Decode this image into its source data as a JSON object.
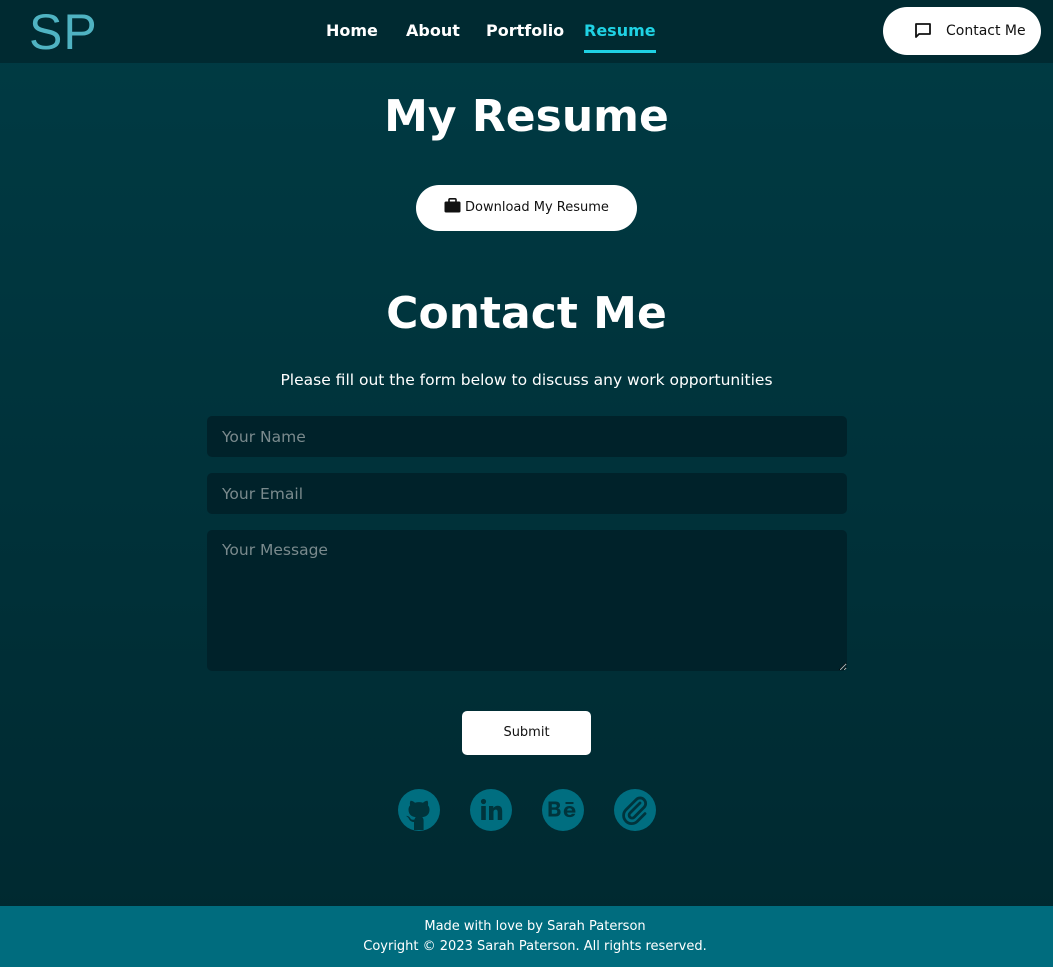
{
  "header": {
    "logo": "SP",
    "nav": [
      {
        "label": "Home",
        "active": false
      },
      {
        "label": "About",
        "active": false
      },
      {
        "label": "Portfolio",
        "active": false
      },
      {
        "label": "Resume",
        "active": true
      }
    ],
    "contact_button": {
      "label": "Contact Me",
      "icon": "chat-bubble-icon"
    }
  },
  "resume": {
    "title": "My Resume",
    "download_button": {
      "label": "Download My Resume",
      "icon": "briefcase-icon"
    }
  },
  "contact": {
    "title": "Contact Me",
    "subtitle": "Please fill out the form below to discuss any work opportunities",
    "name_placeholder": "Your Name",
    "email_placeholder": "Your Email",
    "message_placeholder": "Your Message",
    "submit_label": "Submit"
  },
  "social": [
    {
      "icon": "github-icon"
    },
    {
      "icon": "linkedin-icon"
    },
    {
      "icon": "behance-icon"
    },
    {
      "icon": "paperclip-icon"
    }
  ],
  "footer": {
    "line1": "Made with love by Sarah Paterson",
    "line2": "Coyright © 2023 Sarah Paterson. All rights reserved."
  },
  "colors": {
    "background": "#003b44",
    "header": "#002a31",
    "accent": "#1fd2e4",
    "logo": "#4fb3c2",
    "field": "#00222a",
    "social_icon": "#006e80",
    "footer": "#006c7e"
  }
}
